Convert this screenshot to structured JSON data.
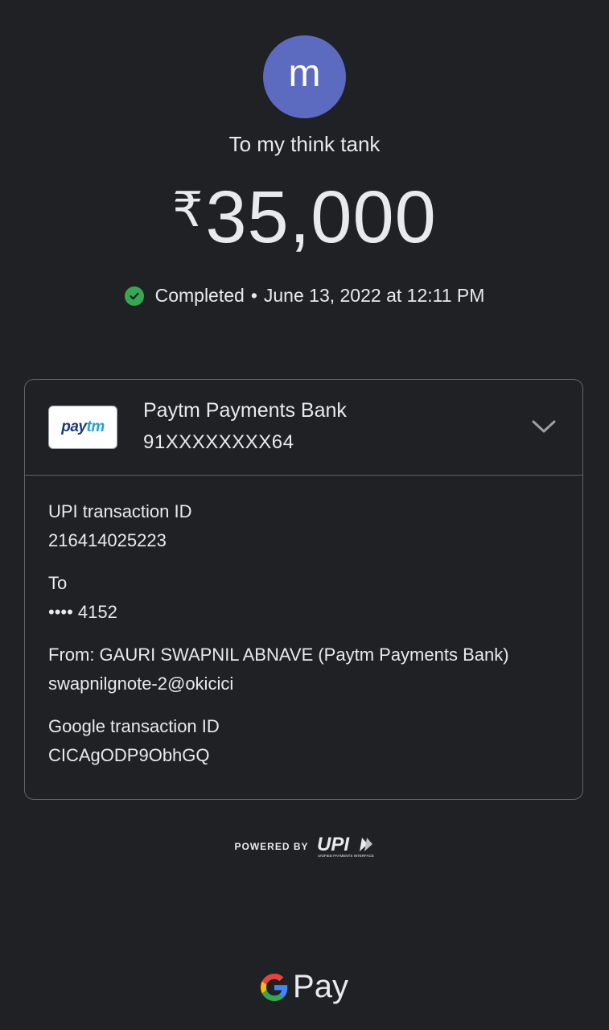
{
  "payee": {
    "avatar_letter": "m",
    "title": "To my think tank",
    "currency_symbol": "₹",
    "amount": "35,000",
    "status": "Completed",
    "separator": "•",
    "datetime": "June 13, 2022 at 12:11 PM"
  },
  "bank": {
    "logo_text_a": "pay",
    "logo_text_b": "tm",
    "name": "Paytm Payments Bank",
    "account": "91XXXXXXXX64"
  },
  "details": [
    {
      "label": "UPI transaction ID",
      "value": "216414025223"
    },
    {
      "label": "To",
      "value": "•••• 4152"
    },
    {
      "label": "From: GAURI SWAPNIL ABNAVE (Paytm Payments Bank)",
      "value": "swapnilgnote-2@okicici"
    },
    {
      "label": "Google transaction ID",
      "value": "CICAgODP9ObhGQ"
    }
  ],
  "footer": {
    "powered_by": "POWERED BY",
    "upi_logo": "UPI",
    "upi_tagline": "UNIFIED PAYMENTS INTERFACE",
    "gpay_label": "Pay"
  },
  "colors": {
    "background": "#202124",
    "avatar": "#5c6bc0",
    "success": "#34a853"
  }
}
